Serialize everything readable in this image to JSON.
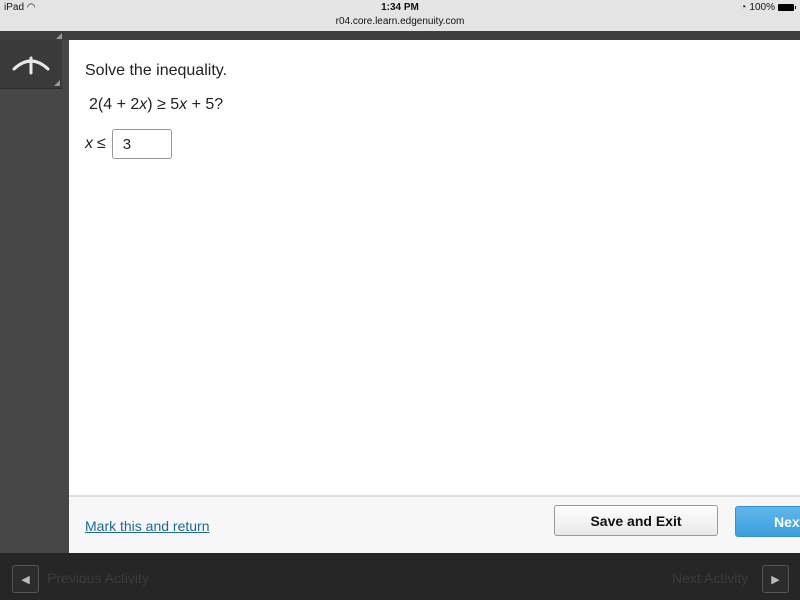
{
  "status_bar": {
    "device": "iPad",
    "time": "1:34 PM",
    "url": "r04.core.learn.edgenuity.com",
    "battery": "100%"
  },
  "question": {
    "prompt": "Solve the inequality.",
    "equation_parts": [
      "2(4 + 2",
      "x",
      ") ≥ 5",
      "x",
      " + 5?"
    ],
    "answer_variable": "x",
    "answer_relation": "≤",
    "answer_value": "3"
  },
  "footer": {
    "mark_link": "Mark this and return",
    "save_exit": "Save and Exit",
    "next": "Next"
  },
  "bottom_nav": {
    "previous": "Previous Activity",
    "next": "Next Activity"
  }
}
